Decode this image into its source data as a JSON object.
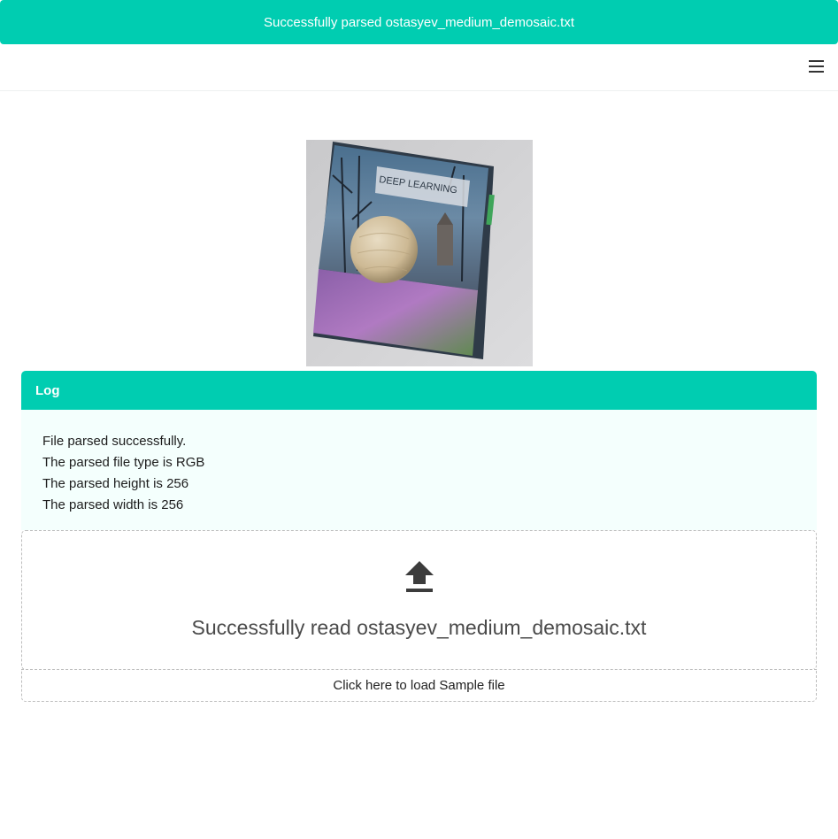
{
  "toast": {
    "message": "Successfully parsed ostasyev_medium_demosaic.txt",
    "color": "#00cdb1"
  },
  "navbar": {
    "menu_icon": "hamburger-menu-icon"
  },
  "preview": {
    "cover_text": "DEEP LEARNING"
  },
  "log": {
    "title": "Log",
    "lines": [
      "File parsed successfully.",
      "The parsed file type is RGB",
      "The parsed height is 256",
      "The parsed width is 256"
    ],
    "header_color": "#00cdb1",
    "body_color": "#f4fffd"
  },
  "dropzone": {
    "icon": "upload-icon",
    "message": "Successfully read ostasyev_medium_demosaic.txt"
  },
  "sample": {
    "label": "Click here to load Sample file"
  }
}
